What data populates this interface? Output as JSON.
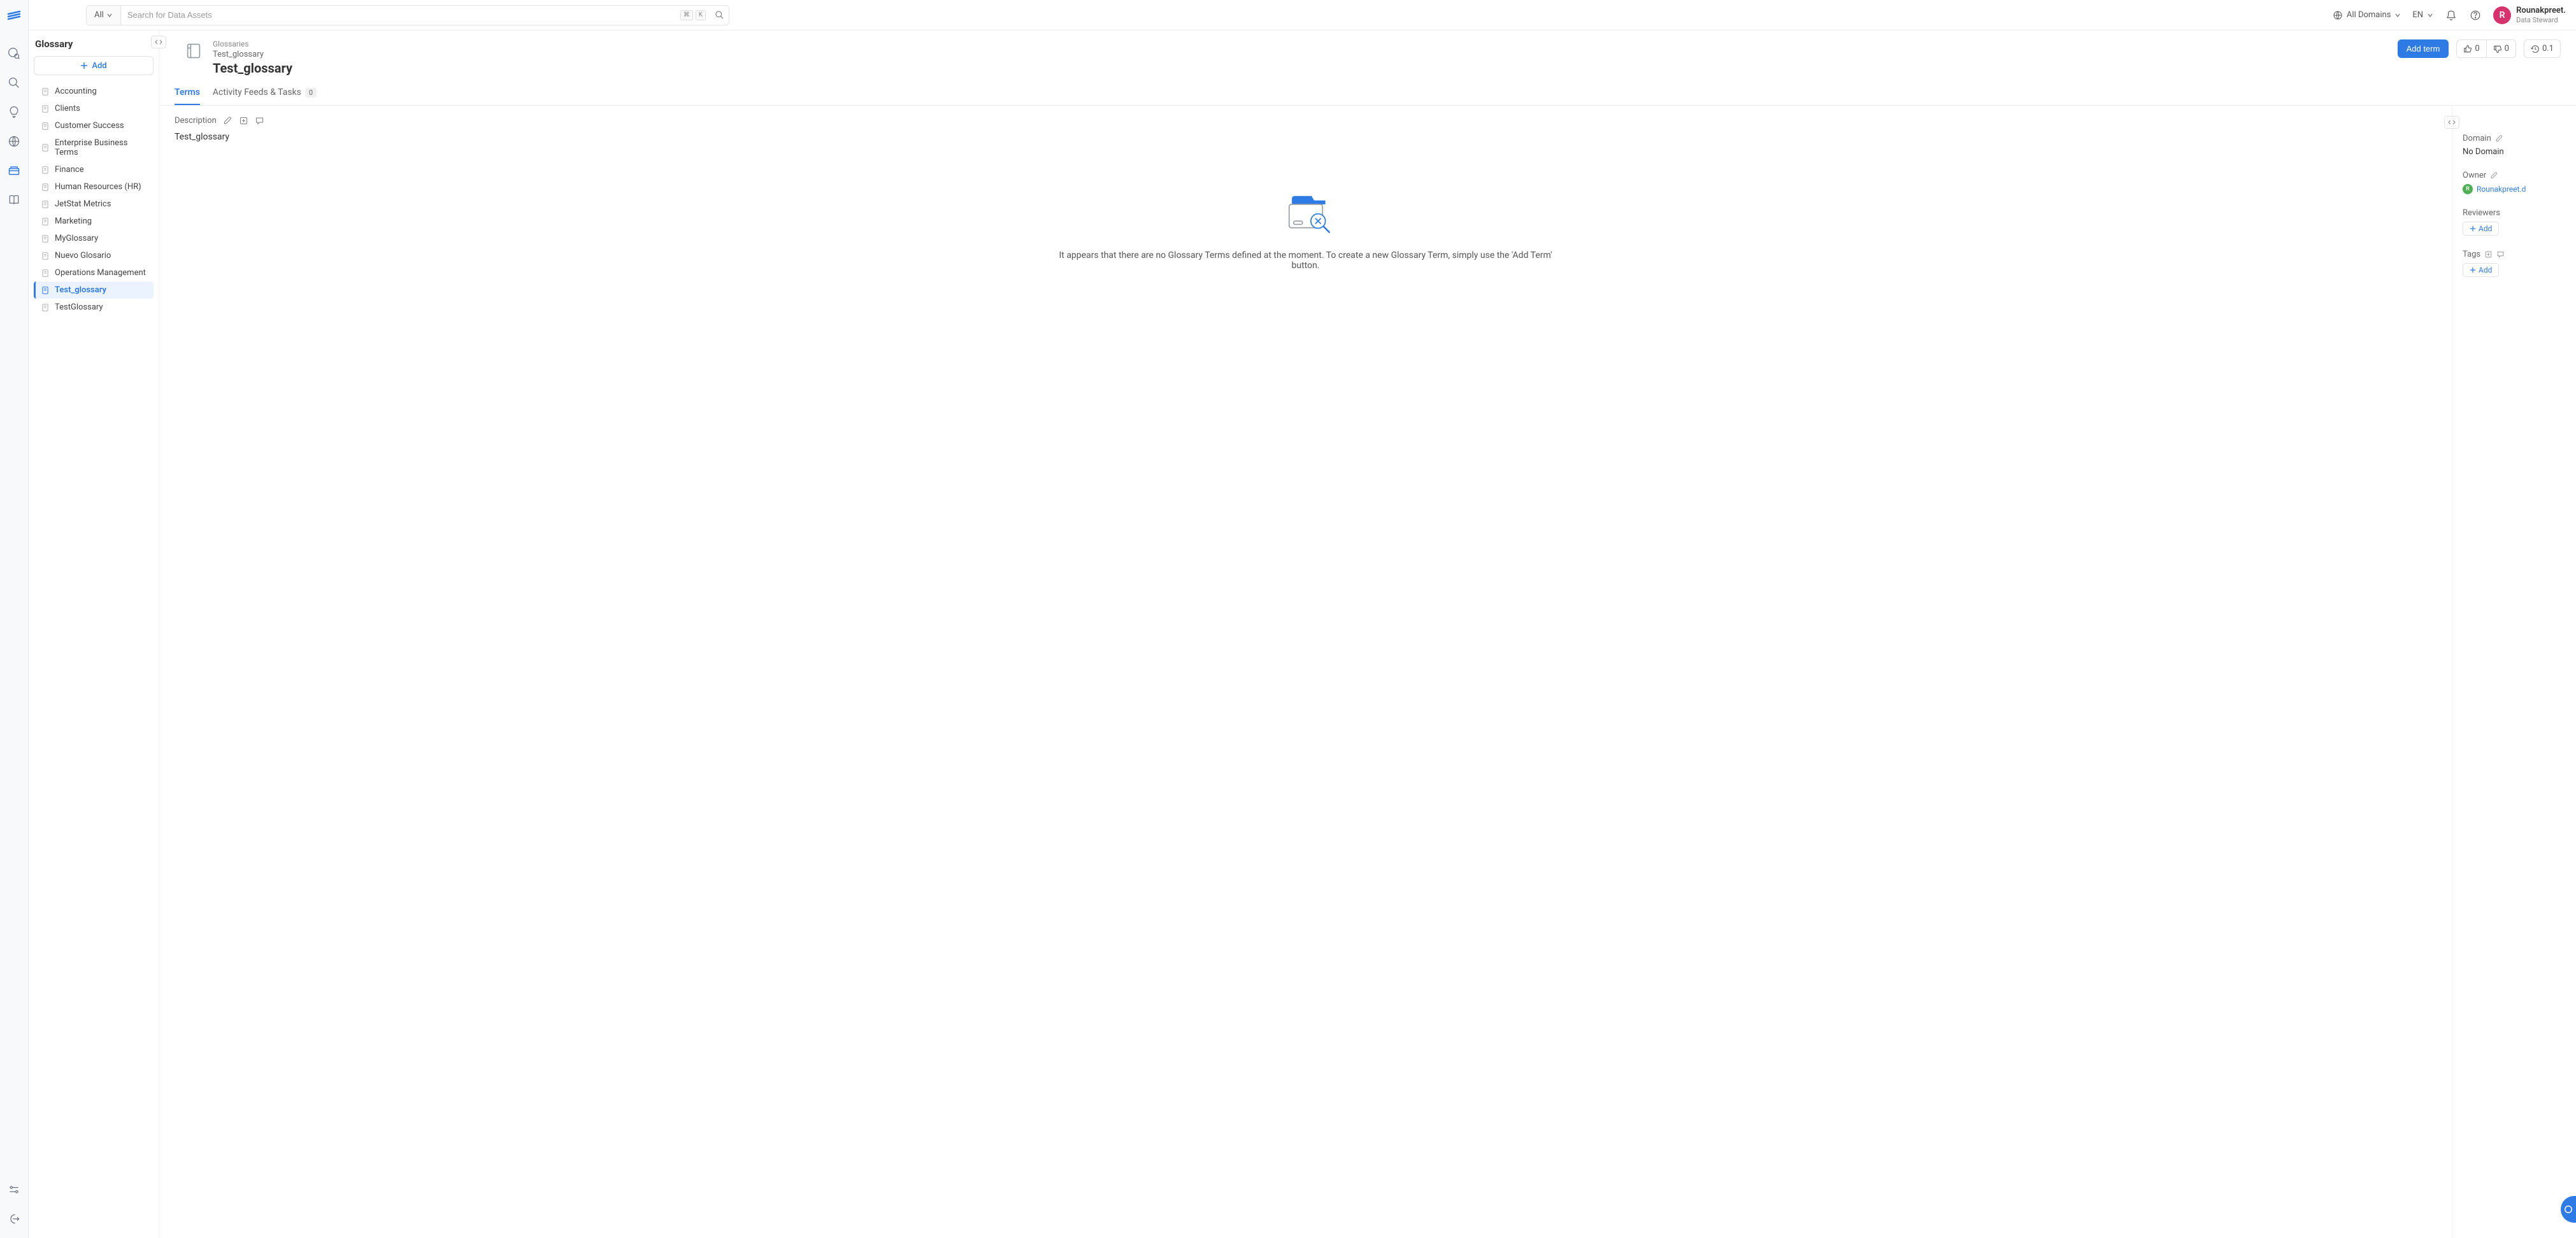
{
  "header": {
    "search_filter": "All",
    "search_placeholder": "Search for Data Assets",
    "kbd1": "⌘",
    "kbd2": "K",
    "domains_label": "All Domains",
    "lang_label": "EN",
    "user_initial": "R",
    "user_name": "Rounakpreet.",
    "user_role": "Data Steward"
  },
  "list_panel": {
    "title": "Glossary",
    "add_label": "Add",
    "items": [
      {
        "label": "Accounting"
      },
      {
        "label": "Clients"
      },
      {
        "label": "Customer Success"
      },
      {
        "label": "Enterprise Business Terms"
      },
      {
        "label": "Finance"
      },
      {
        "label": "Human Resources (HR)"
      },
      {
        "label": "JetStat Metrics"
      },
      {
        "label": "Marketing"
      },
      {
        "label": "MyGlossary"
      },
      {
        "label": "Nuevo Glosario"
      },
      {
        "label": "Operations Management"
      },
      {
        "label": "Test_glossary"
      },
      {
        "label": "TestGlossary"
      }
    ],
    "selected_index": 11
  },
  "content": {
    "breadcrumb": "Glossaries",
    "sub_breadcrumb": "Test_glossary",
    "title": "Test_glossary",
    "add_term_label": "Add term",
    "upvotes": "0",
    "downvotes": "0",
    "version": "0.1",
    "tabs": {
      "terms": "Terms",
      "activity": "Activity Feeds & Tasks",
      "activity_count": "0"
    },
    "description_label": "Description",
    "description_text": "Test_glossary",
    "empty_message": "It appears that there are no Glossary Terms defined at the moment. To create a new Glossary Term, simply use the 'Add Term' button."
  },
  "right_panel": {
    "domain_label": "Domain",
    "domain_value": "No Domain",
    "owner_label": "Owner",
    "owner_initial": "R",
    "owner_name": "Rounakpreet.d",
    "reviewers_label": "Reviewers",
    "reviewers_add": "Add",
    "tags_label": "Tags",
    "tags_add": "Add"
  }
}
